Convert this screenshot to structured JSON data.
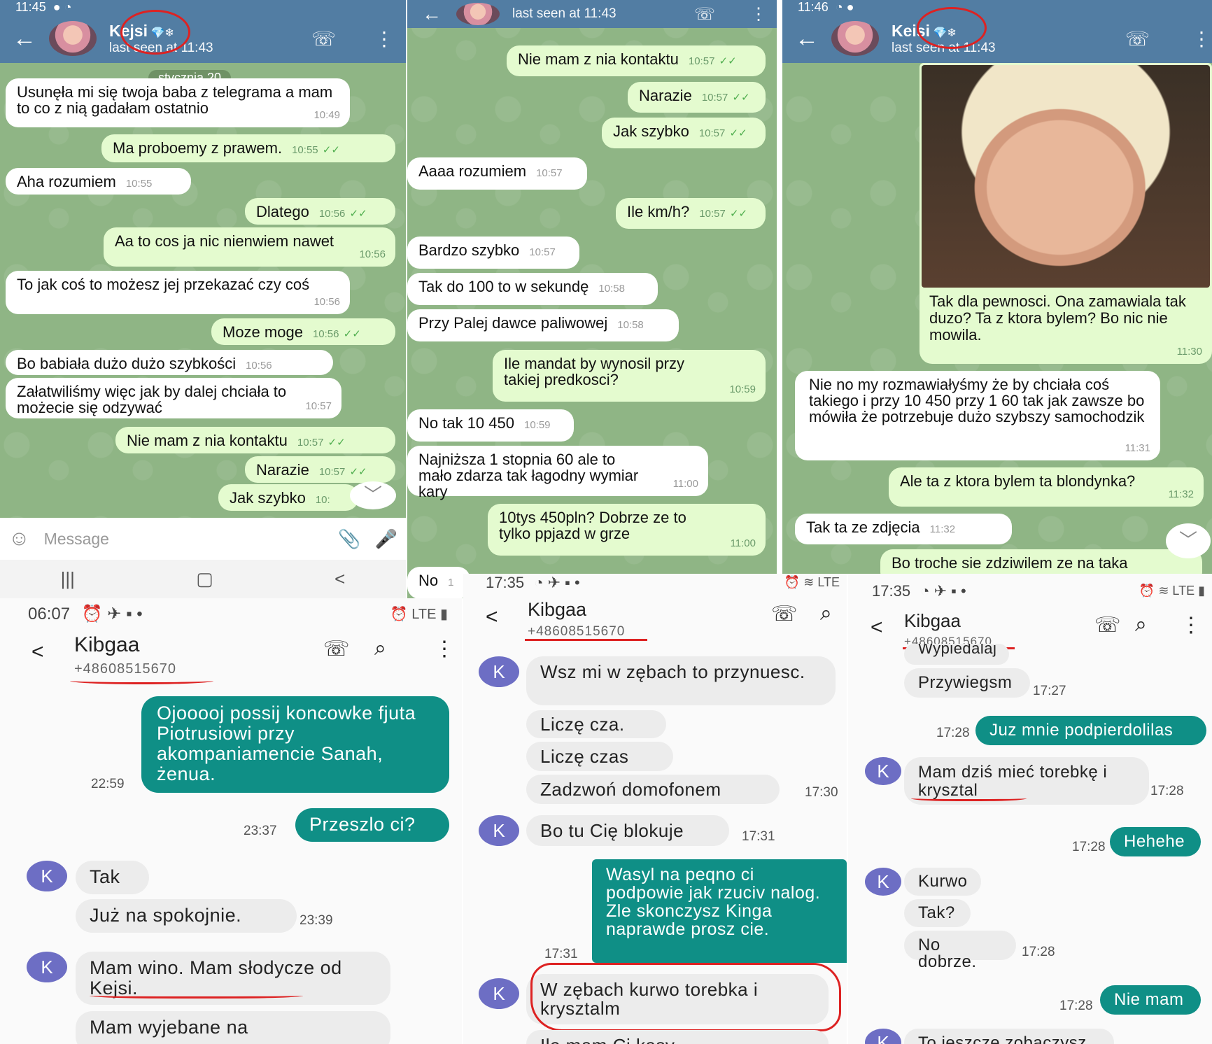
{
  "p1": {
    "status_time": "11:45",
    "contact": "Kejsi",
    "contact_emoji": "💎❄",
    "last_seen": "last seen at 11:43",
    "date_badge": "stycznia 20",
    "messages": [
      {
        "text": "Usunęła mi się twoja baba z telegrama a mam to co z nią gadałam ostatnio",
        "time": "10:49"
      },
      {
        "text": "Ma proboemy z prawem.",
        "time": "10:55"
      },
      {
        "text": "Aha rozumiem",
        "time": "10:55"
      },
      {
        "text": "Dlatego",
        "time": "10:56"
      },
      {
        "text": "Aa to cos ja nic nienwiem nawet",
        "time": "10:56"
      },
      {
        "text": "To jak coś to możesz jej przekazać czy coś",
        "time": "10:56"
      },
      {
        "text": "Moze moge",
        "time": "10:56"
      },
      {
        "text": "Bo babiała dużo dużo szybkości",
        "time": "10:56"
      },
      {
        "text": "Załatwiliśmy więc jak by dalej chciała to możecie się odzywać",
        "time": "10:57"
      },
      {
        "text": "Nie mam z nia kontaktu",
        "time": "10:57"
      },
      {
        "text": "Narazie",
        "time": "10:57"
      },
      {
        "text": "Jak szybko",
        "time": "10:"
      }
    ],
    "input_placeholder": "Message"
  },
  "p2": {
    "last_seen": "last seen at 11:43",
    "messages": [
      {
        "text": "Nie mam z nia kontaktu",
        "time": "10:57"
      },
      {
        "text": "Narazie",
        "time": "10:57"
      },
      {
        "text": "Jak szybko",
        "time": "10:57"
      },
      {
        "text": "Aaaa rozumiem",
        "time": "10:57"
      },
      {
        "text": "Ile km/h?",
        "time": "10:57"
      },
      {
        "text": "Bardzo szybko",
        "time": "10:57"
      },
      {
        "text": "Tak do 100 to w sekundę",
        "time": "10:58"
      },
      {
        "text": "Przy Palej dawce paliwowej",
        "time": "10:58"
      },
      {
        "text": "Ile mandat by wynosil przy takiej predkosci?",
        "time": "10:59"
      },
      {
        "text": "No tak 10 450",
        "time": "10:59"
      },
      {
        "text": "Najniższa 1 stopnia 60 ale to mało zdarza tak łagodny wymiar kary",
        "time": "11:00"
      },
      {
        "text": "10tys 450pln? Dobrze ze to tylko ppjazd w grze",
        "time": "11:00"
      },
      {
        "text": "No",
        "time": "1"
      }
    ]
  },
  "p3": {
    "status_time": "11:46",
    "contact": "Keisi",
    "contact_emoji": "💎❄",
    "last_seen": "last seen at 11:43",
    "messages": [
      {
        "text": "Tak dla pewnosci. Ona zamawiala tak duzo? Ta z ktora bylem? Bo nic nie mowila.",
        "time": "11:30"
      },
      {
        "text": "Nie no my rozmawiałyśmy że by chciała coś takiego i przy 10 450 przy 1 60 tak jak zawsze bo mówiła że potrzebuje dużo szybszy samochodzik",
        "time": "11:31"
      },
      {
        "text": "Ale ta z ktora bylem ta blondynka?",
        "time": "11:32"
      },
      {
        "text": "Tak ta ze zdjęcia",
        "time": "11:32"
      },
      {
        "text": "Bo troche sie zdziwilem ze na taka",
        "time": ""
      }
    ]
  },
  "p4": {
    "status_time": "06:07",
    "contact": "Kibgaa",
    "phone": "+48608515670",
    "messages": [
      {
        "text": "Ojooooj possij koncowke fjuta Piotrusiowi przy akompaniamencie Sanah, żenua.",
        "time": "22:59"
      },
      {
        "text": "Przeszlo ci?",
        "time": "23:37"
      },
      {
        "text": "Tak",
        "time": ""
      },
      {
        "text": "Już na spokojnie.",
        "time": "23:39"
      },
      {
        "text": "Mam wino. Mam słodycze od Kejsi.",
        "time": ""
      },
      {
        "text": "Mam wyjebane na",
        "time": ""
      }
    ],
    "avatar_letter": "K"
  },
  "p5": {
    "status_time": "17:35",
    "contact": "Kibgaa",
    "phone": "+48608515670",
    "messages": [
      {
        "text": "Wsz mi w zębach to przynuesc.",
        "time": ""
      },
      {
        "text": "Liczę cza.",
        "time": ""
      },
      {
        "text": "Liczę czas",
        "time": ""
      },
      {
        "text": "Zadzwoń domofonem",
        "time": "17:30"
      },
      {
        "text": "Bo tu Cię blokuje",
        "time": "17:31"
      },
      {
        "text": "Wasyl na peqno ci podpowie jak rzuciv nalog. Zle skonczysz Kinga naprawde prosz cie.",
        "time": "17:31"
      },
      {
        "text": "W zębach kurwo torebka i krysztalm",
        "time": ""
      },
      {
        "text": "Ile mam Ci kasy",
        "time": ""
      }
    ],
    "avatar_letter": "K"
  },
  "p6": {
    "status_time": "17:35",
    "contact": "Kibgaa",
    "phone": "+48608515670",
    "messages": [
      {
        "text": "Wypiedalaj",
        "time": ""
      },
      {
        "text": "Przywiegsm",
        "time": "17:27"
      },
      {
        "text": "Juz mnie podpierdolilas",
        "time": "17:28"
      },
      {
        "text": "Mam dziś mieć torebkę i krysztal",
        "time": "17:28"
      },
      {
        "text": "Hehehe",
        "time": "17:28"
      },
      {
        "text": "Kurwo",
        "time": ""
      },
      {
        "text": "Tak?",
        "time": ""
      },
      {
        "text": "No dobrze.",
        "time": "17:28"
      },
      {
        "text": "Nie mam",
        "time": "17:28"
      },
      {
        "text": "To jeszcze zobaczysz",
        "time": ""
      }
    ],
    "avatar_letter": "K"
  }
}
